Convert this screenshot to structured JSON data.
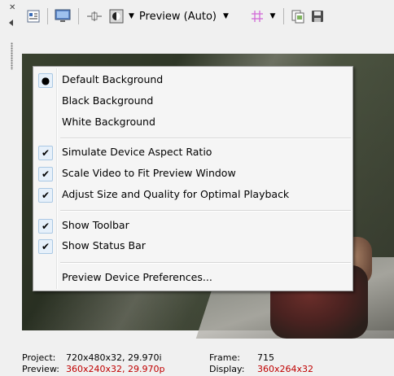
{
  "toolbar": {
    "preview_quality_label": "Preview (Auto)",
    "icons": [
      "close-x-icon",
      "pin-icon",
      "video-properties-icon",
      "external-monitor-icon",
      "split-screen-icon",
      "overlays-icon",
      "preview-quality-dropdown",
      "grid-icon",
      "copy-snapshot-icon",
      "save-snapshot-icon"
    ]
  },
  "menu": {
    "items": [
      {
        "label": "Default Background",
        "mark": "radio"
      },
      {
        "label": "Black Background",
        "mark": ""
      },
      {
        "label": "White Background",
        "mark": ""
      },
      {
        "label": "Simulate Device Aspect Ratio",
        "mark": "check"
      },
      {
        "label": "Scale Video to Fit Preview Window",
        "mark": "check"
      },
      {
        "label": "Adjust Size and Quality for Optimal Playback",
        "mark": "check"
      },
      {
        "label": "Show Toolbar",
        "mark": "check"
      },
      {
        "label": "Show Status Bar",
        "mark": "check"
      },
      {
        "label": "Preview Device Preferences...",
        "mark": ""
      }
    ]
  },
  "status": {
    "project_label": "Project:",
    "project_value": "720x480x32, 29.970i",
    "preview_label": "Preview:",
    "preview_value": "360x240x32, 29.970p",
    "frame_label": "Frame:",
    "frame_value": "715",
    "display_label": "Display:",
    "display_value": "360x264x32"
  },
  "colors": {
    "status_red": "#c00000",
    "menu_border": "#979797",
    "check_bg": "#e6f0fa"
  }
}
